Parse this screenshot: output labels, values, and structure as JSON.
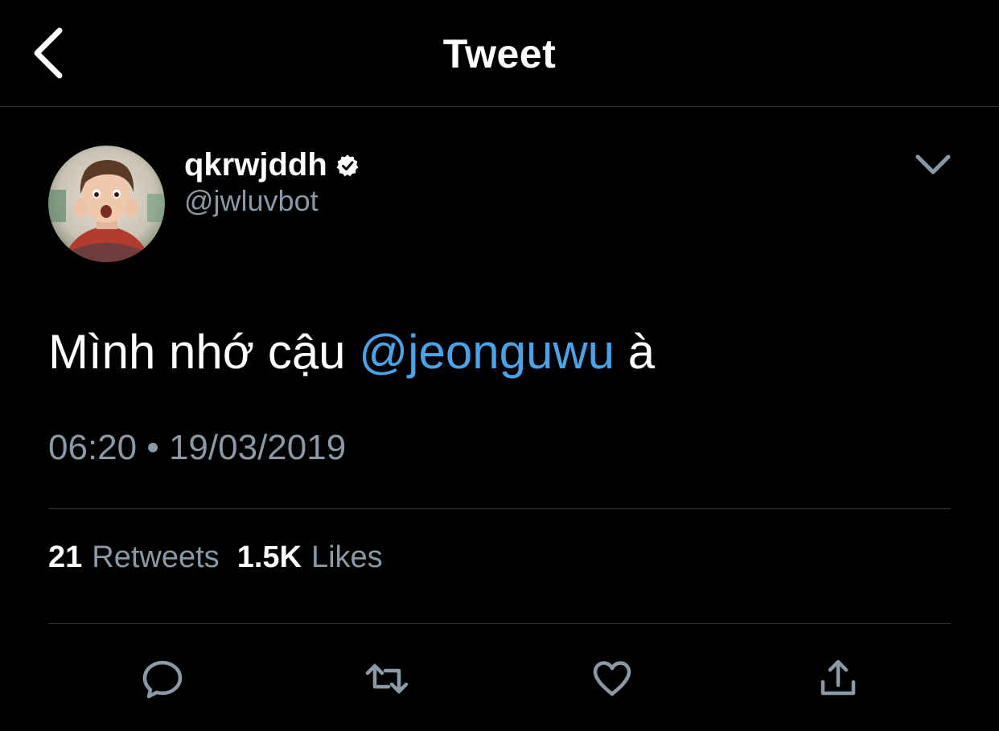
{
  "header": {
    "title": "Tweet"
  },
  "author": {
    "display_name": "qkrwjddh",
    "handle": "@jwluvbot",
    "verified": true
  },
  "tweet": {
    "text_before": "Mình nhớ cậu ",
    "mention": "@jeonguwu",
    "text_after": " à",
    "timestamp": "06:20 • 19/03/2019"
  },
  "stats": {
    "retweets_count": "21",
    "retweets_label": "Retweets",
    "likes_count": "1.5K",
    "likes_label": "Likes"
  },
  "icons": {
    "back": "chevron-left-icon",
    "more": "chevron-down-icon",
    "verified": "verified-badge-icon",
    "reply": "reply-icon",
    "retweet": "retweet-icon",
    "like": "heart-icon",
    "share": "share-icon"
  },
  "colors": {
    "background": "#000000",
    "text_primary": "#ffffff",
    "text_secondary": "#8b98a5",
    "link": "#4aa3e8",
    "divider": "#2f3336"
  }
}
